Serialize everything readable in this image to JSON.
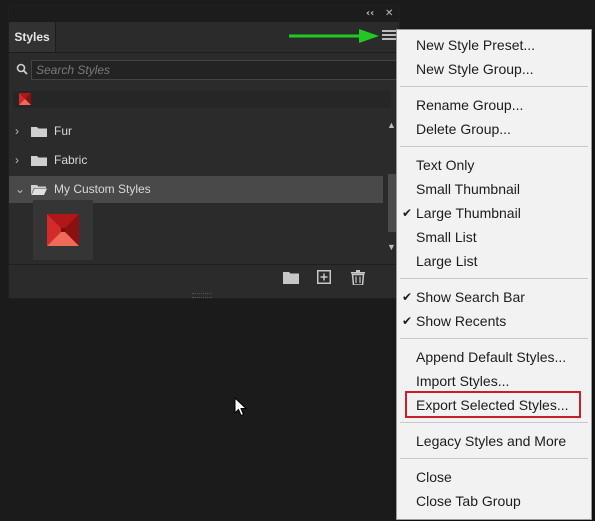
{
  "panel": {
    "tab_title": "Styles",
    "collapse_glyph": "‹‹",
    "close_glyph": "✕",
    "search_placeholder": "Search Styles",
    "groups": [
      {
        "label": "Fur",
        "expanded": false
      },
      {
        "label": "Fabric",
        "expanded": false
      },
      {
        "label": "My Custom Styles",
        "expanded": true
      }
    ],
    "bottom_icons": [
      "new-group-folder-icon",
      "new-style-icon",
      "trash-icon"
    ]
  },
  "colors": {
    "panel_bg": "#2b2b2b",
    "selected_row": "#494949",
    "annotation_arrow": "#22c822",
    "highlight_box": "#c8202a",
    "menu_bg": "#f2f2f2"
  },
  "menu": {
    "items": [
      {
        "label": "New Style Preset...",
        "checked": false
      },
      {
        "label": "New Style Group...",
        "checked": false
      },
      {
        "label": "Rename Group...",
        "checked": false
      },
      {
        "label": "Delete Group...",
        "checked": false
      },
      {
        "label": "Text Only",
        "checked": false
      },
      {
        "label": "Small Thumbnail",
        "checked": false
      },
      {
        "label": "Large Thumbnail",
        "checked": true
      },
      {
        "label": "Small List",
        "checked": false
      },
      {
        "label": "Large List",
        "checked": false
      },
      {
        "label": "Show Search Bar",
        "checked": true
      },
      {
        "label": "Show Recents",
        "checked": true
      },
      {
        "label": "Append Default Styles...",
        "checked": false
      },
      {
        "label": "Import Styles...",
        "checked": false
      },
      {
        "label": "Export Selected Styles...",
        "checked": false,
        "highlighted": true
      },
      {
        "label": "Legacy Styles and More",
        "checked": false
      },
      {
        "label": "Close",
        "checked": false
      },
      {
        "label": "Close Tab Group",
        "checked": false
      }
    ],
    "check_glyph": "✔"
  }
}
